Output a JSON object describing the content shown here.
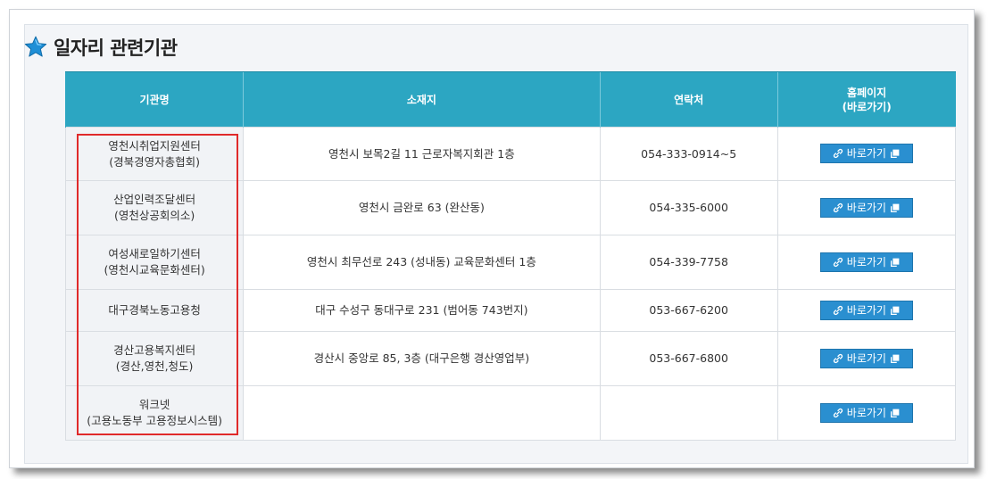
{
  "page": {
    "title": "일자리 관련기관"
  },
  "table": {
    "headers": {
      "name": "기관명",
      "address": "소재지",
      "phone": "연락처",
      "homepage_line1": "홈페이지",
      "homepage_line2": "(바로가기)"
    },
    "rows": [
      {
        "name_line1": "영천시취업지원센터",
        "name_line2": "(경북경영자총협회)",
        "address": "영천시 보목2길 11 근로자복지회관 1층",
        "phone": "054-333-0914~5",
        "button": "바로가기"
      },
      {
        "name_line1": "산업인력조달센터",
        "name_line2": "(영천상공회의소)",
        "address": "영천시 금완로 63 (완산동)",
        "phone": "054-335-6000",
        "button": "바로가기"
      },
      {
        "name_line1": "여성새로일하기센터",
        "name_line2": "(영천시교육문화센터)",
        "address": "영천시 최무선로 243 (성내동) 교육문화센터 1층",
        "phone": "054-339-7758",
        "button": "바로가기"
      },
      {
        "name_line1": "대구경북노동고용청",
        "name_line2": "",
        "address": "대구 수성구 동대구로 231 (범어동 743번지)",
        "phone": "053-667-6200",
        "button": "바로가기"
      },
      {
        "name_line1": "경산고용복지센터",
        "name_line2": "(경산,영천,청도)",
        "address": "경산시 중앙로 85, 3층 (대구은행 경산영업부)",
        "phone": "053-667-6800",
        "button": "바로가기"
      },
      {
        "name_line1": "워크넷",
        "name_line2": "(고용노동부 고용정보시스템)",
        "address": "",
        "phone": "",
        "button": "바로가기"
      }
    ]
  },
  "colors": {
    "header_bg": "#2ca6c2",
    "button_bg": "#2a8fd0",
    "highlight_border": "#e02a2a",
    "star": "#1f8fd6"
  },
  "icons": {
    "title": "star-icon",
    "button": "link-icon",
    "button_suffix": "new-window-icon"
  }
}
